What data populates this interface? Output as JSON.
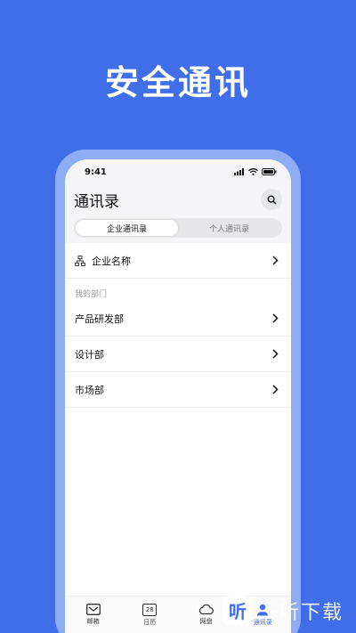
{
  "headline": "安全通讯",
  "status_bar": {
    "time": "9:41"
  },
  "header": {
    "title": "通讯录",
    "tabs": [
      {
        "label": "企业通讯录",
        "active": true
      },
      {
        "label": "个人通讯录",
        "active": false
      }
    ]
  },
  "company_row": {
    "label": "企业名称"
  },
  "my_departments": {
    "section_label": "我的部门",
    "items": [
      "产品研发部",
      "设计部",
      "市场部"
    ]
  },
  "tab_bar": {
    "items": [
      {
        "label": "邮箱",
        "icon": "mail-icon"
      },
      {
        "label": "日历",
        "icon": "calendar-icon",
        "icon_text": "28"
      },
      {
        "label": "网盘",
        "icon": "cloud-icon"
      },
      {
        "label": "通讯录",
        "icon": "contacts-icon",
        "active": true
      }
    ]
  },
  "watermark": {
    "logo_char": "听",
    "text": "一听下载"
  },
  "colors": {
    "brand_blue": "#3f6ee8",
    "frame": "#8fadf5"
  }
}
